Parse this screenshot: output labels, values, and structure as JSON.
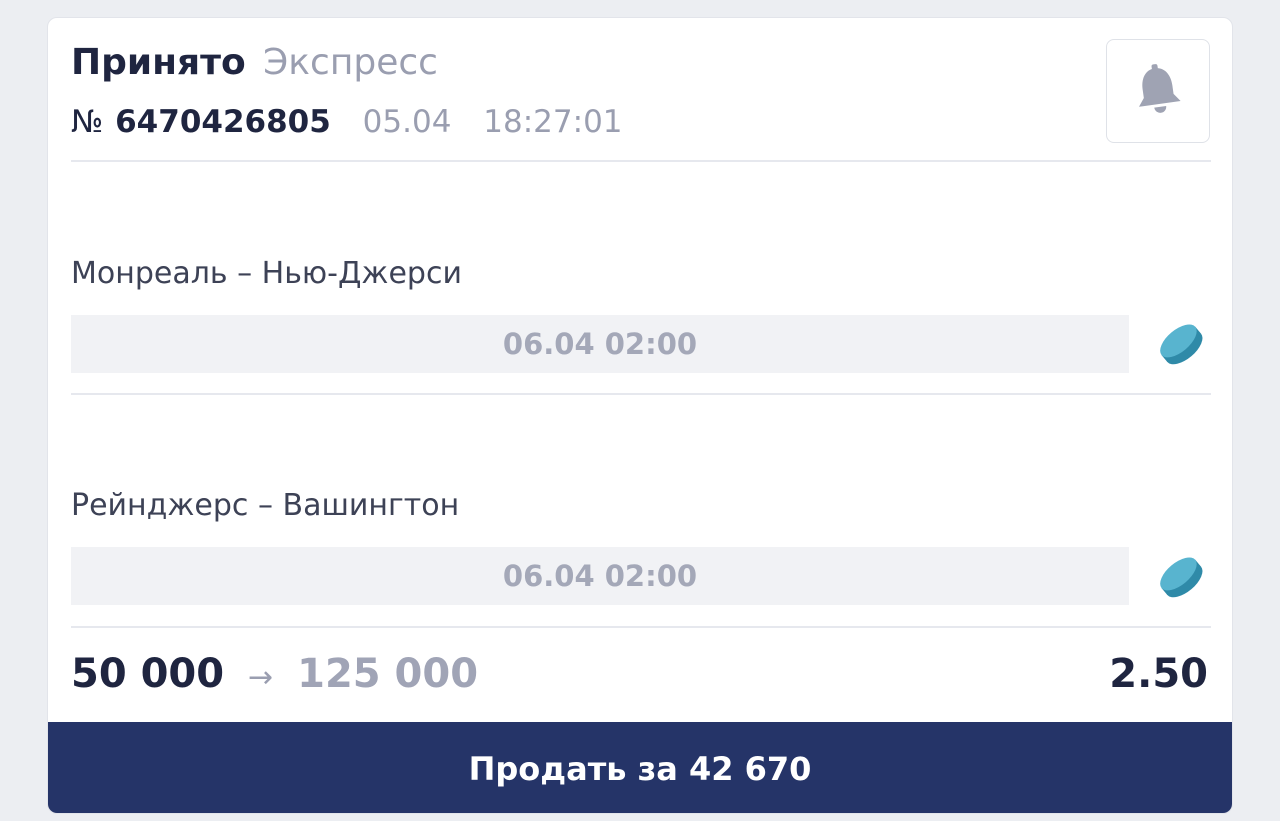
{
  "header": {
    "status": "Принято",
    "bet_type": "Экспресс",
    "number_label": "№",
    "number": "6470426805",
    "date": "05.04",
    "time": "18:27:01"
  },
  "events": [
    {
      "title": "Монреаль – Нью-Джерси",
      "datetime": "06.04 02:00",
      "sport_icon": "hockey-puck-icon"
    },
    {
      "title": "Рейнджерс – Вашингтон",
      "datetime": "06.04 02:00",
      "sport_icon": "hockey-puck-icon"
    }
  ],
  "summary": {
    "stake": "50 000",
    "arrow": "→",
    "payout": "125 000",
    "odds": "2.50"
  },
  "sell_button": {
    "label": "Продать за 42 670"
  },
  "colors": {
    "primary": "#253468",
    "accent_icon": "#4aa8c4",
    "muted_text": "#9a9eb0",
    "dark_text": "#1f2540"
  }
}
